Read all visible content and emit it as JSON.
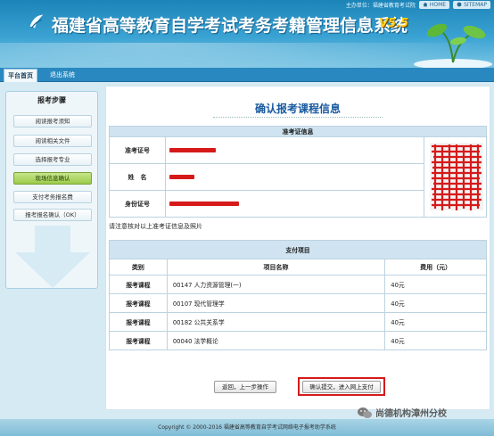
{
  "header": {
    "title": "福建省高等教育自学考试考务考籍管理信息系统",
    "version": "V5.5",
    "unit_text": "主办单位：福建省教育考试院",
    "home_label": "HOME",
    "sitemap_label": "SITEMAP"
  },
  "nav": {
    "tabs": [
      {
        "label": "平台首页",
        "active": true
      },
      {
        "label": "退出系统",
        "active": false
      }
    ]
  },
  "sidebar": {
    "heading": "报考步骤",
    "items": [
      {
        "label": "阅读报考须知",
        "active": false
      },
      {
        "label": "阅读相关文件",
        "active": false
      },
      {
        "label": "选择报考专业",
        "active": false
      },
      {
        "label": "现场信息确认",
        "active": true
      },
      {
        "label": "支付考务报名费",
        "active": false
      },
      {
        "label": "报考报名确认（OK）",
        "active": false
      }
    ]
  },
  "main": {
    "title": "确认报考课程信息",
    "ticket": {
      "section_title": "准考证信息",
      "fields": [
        {
          "label": "准考证号",
          "value": ""
        },
        {
          "label": "姓　名",
          "value": ""
        },
        {
          "label": "身份证号",
          "value": ""
        }
      ]
    },
    "notice": "请注意核对以上准考证信息及照片",
    "payment": {
      "section_title": "支付项目",
      "columns": [
        "类别",
        "项目名称",
        "费用（元）"
      ],
      "rows": [
        {
          "category": "报考课程",
          "name": "00147 人力资源管理(一)",
          "fee": "40元"
        },
        {
          "category": "报考课程",
          "name": "00107 现代管理学",
          "fee": "40元"
        },
        {
          "category": "报考课程",
          "name": "00182 公共关系学",
          "fee": "40元"
        },
        {
          "category": "报考课程",
          "name": "00040 法学概论",
          "fee": "40元"
        }
      ]
    },
    "buttons": {
      "back": "返回，上一步操作",
      "submit": "确认提交，进入网上支付"
    }
  },
  "footer": {
    "copyright": "Copyright © 2000-2016  福建省高等教育自学考试网络电子报考助学系统"
  },
  "watermark": {
    "text": "尚德机构漳州分校"
  },
  "colors": {
    "header_blue": "#1d84b8",
    "accent_title": "#1a5aa0",
    "active_green": "#9ccc4a",
    "redaction": "#d61a1a",
    "version_yellow": "#ffd21c"
  }
}
